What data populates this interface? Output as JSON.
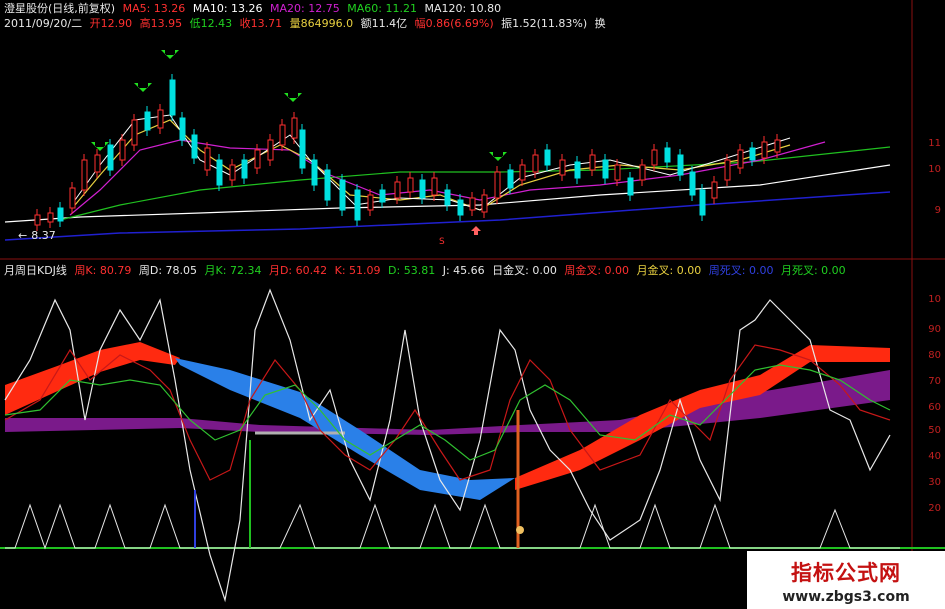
{
  "price_panel": {
    "title": "澄星股份(日线,前复权)",
    "date": "2011/09/20/二",
    "ma5": "MA5: 13.26",
    "ma10": "MA10: 13.26",
    "ma20": "MA20: 12.75",
    "ma60": "MA60: 11.21",
    "ma120": "MA120: 10.80",
    "open": "开12.90",
    "high": "高13.95",
    "low": "低12.43",
    "close": "收13.71",
    "volume": "量864996.0",
    "amount": "额11.4亿",
    "change": "幅0.86(6.69%)",
    "amplitude": "振1.52(11.83%)",
    "more": "换",
    "low_marker": "8.37",
    "s_marker": "S",
    "axis_ticks": [
      "11",
      "10",
      "9"
    ]
  },
  "kdj_panel": {
    "title": "月周日KDJ线",
    "wk_k": "周K: 80.79",
    "wk_d": "周D: 78.05",
    "mo_k": "月K: 72.34",
    "mo_d": "月D: 60.42",
    "k": "K: 51.09",
    "d": "D: 53.81",
    "j": "J: 45.66",
    "day_gold": "日金叉: 0.00",
    "wk_gold": "周金叉: 0.00",
    "mo_gold": "月金叉: 0.00",
    "wk_dead": "周死叉: 0.00",
    "mo_dead": "月死叉: 0.00",
    "axis_ticks": [
      "10",
      "90",
      "80",
      "70",
      "60",
      "50",
      "40",
      "30",
      "20"
    ]
  },
  "watermark": {
    "title": "指标公式网",
    "url": "www.zbgs3.com"
  },
  "colors": {
    "background": "#000000",
    "up": "#ff3030",
    "down": "#00e0e0",
    "ma5": "#ffffff",
    "ma10": "#e8d040",
    "ma20": "#d020d0",
    "ma60": "#20c020",
    "ma120": "#2020d0",
    "ribbon_red": "#ff2a10",
    "ribbon_blue": "#2a80e8",
    "band_purple": "#7a1a8a",
    "baseline_green": "#20c020"
  }
}
